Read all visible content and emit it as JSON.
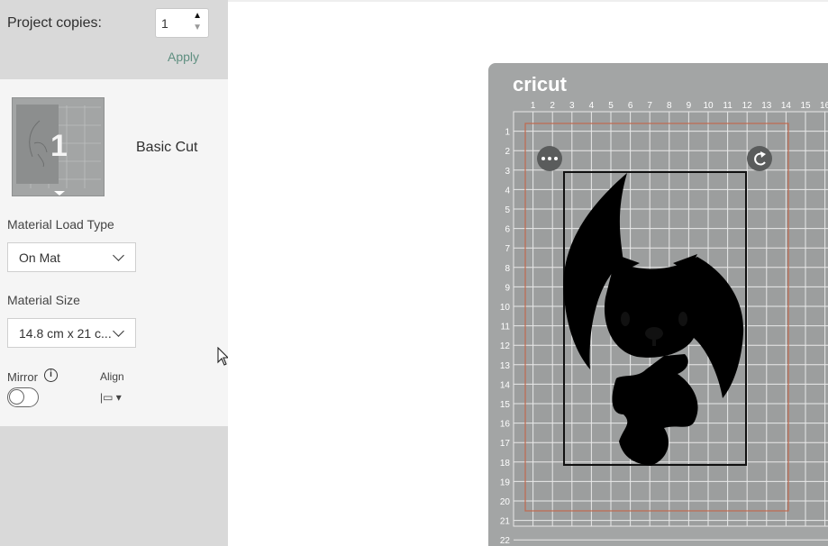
{
  "copies": {
    "label": "Project copies:",
    "value": "1",
    "apply_label": "Apply"
  },
  "mat_item": {
    "number": "1",
    "name": "Basic Cut"
  },
  "material_load": {
    "label": "Material Load Type",
    "value": "On Mat"
  },
  "material_size": {
    "label": "Material Size",
    "value": "14.8 cm x 21 c..."
  },
  "mirror": {
    "label": "Mirror",
    "info_icon": "i"
  },
  "align": {
    "label": "Align",
    "icon": "|▭ ▾"
  },
  "canvas": {
    "logo": "cricut",
    "ruler_top": [
      "1",
      "2",
      "3",
      "4",
      "5",
      "6",
      "7",
      "8",
      "9",
      "10",
      "11",
      "12",
      "13",
      "14",
      "15",
      "16"
    ],
    "ruler_left": [
      "1",
      "2",
      "3",
      "4",
      "5",
      "6",
      "7",
      "8",
      "9",
      "10",
      "11",
      "12",
      "13",
      "14",
      "15",
      "16",
      "17",
      "18",
      "19",
      "20",
      "21",
      "22"
    ]
  },
  "colors": {
    "mat": "#a3a5a5",
    "accent_apply": "#5f8f80",
    "cut_border": "#c0694e"
  }
}
